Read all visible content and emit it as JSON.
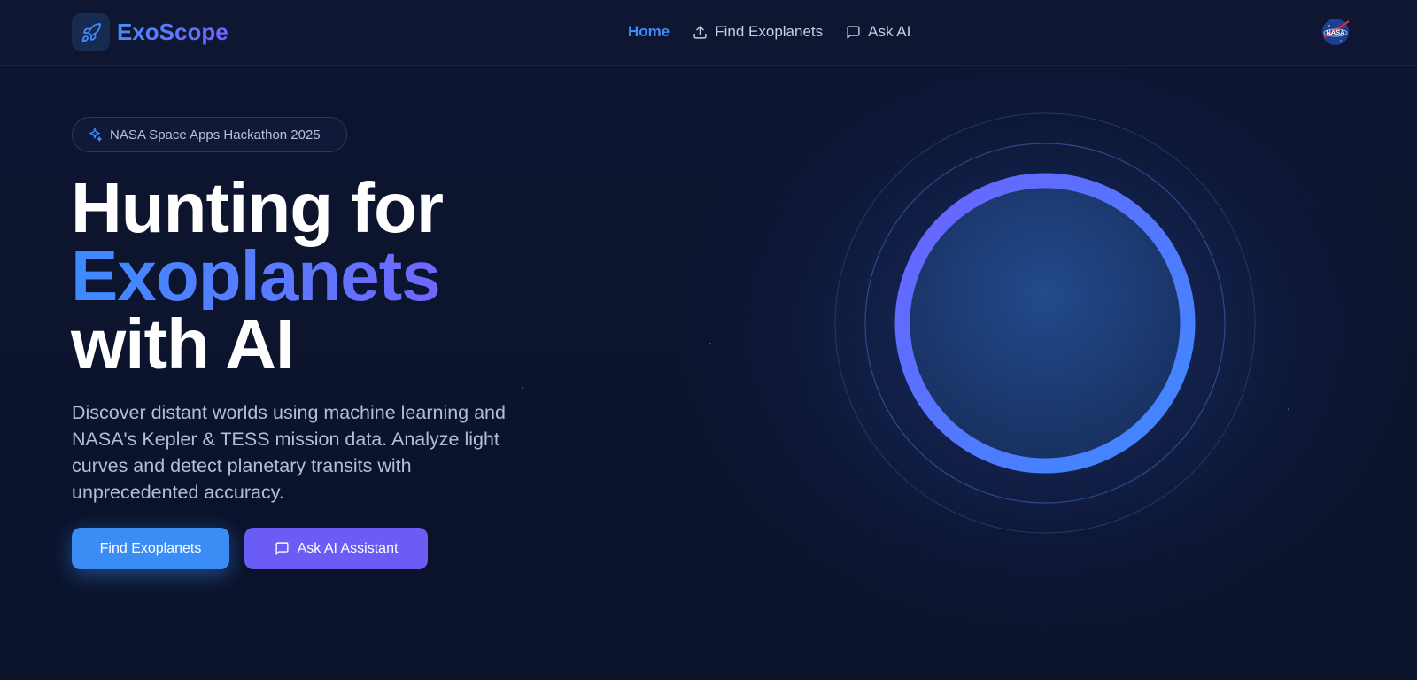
{
  "app": {
    "name": "ExoScope"
  },
  "nav": {
    "items": [
      {
        "label": "Home",
        "icon": "none",
        "active": true
      },
      {
        "label": "Find Exoplanets",
        "icon": "upload-icon",
        "active": false
      },
      {
        "label": "Ask AI",
        "icon": "message-square-icon",
        "active": false
      }
    ],
    "partner_logo": "nasa-logo"
  },
  "hero": {
    "badge": "NASA Space Apps Hackathon 2025",
    "headline": {
      "line1": "Hunting for",
      "line2": "Exoplanets",
      "line3": "with AI"
    },
    "description": "Discover distant worlds using machine learning and NASA's Kepler & TESS mission data. Analyze light curves and detect planetary transits with unprecedented accuracy.",
    "primary_button": "Find Exoplanets",
    "secondary_button": "Ask AI Assistant"
  },
  "colors": {
    "background": "#0b1228",
    "navbar": "#0e1631",
    "accent_blue": "#3d8bff",
    "accent_purple": "#6a5cf5",
    "text_muted": "#b6bfd1"
  }
}
